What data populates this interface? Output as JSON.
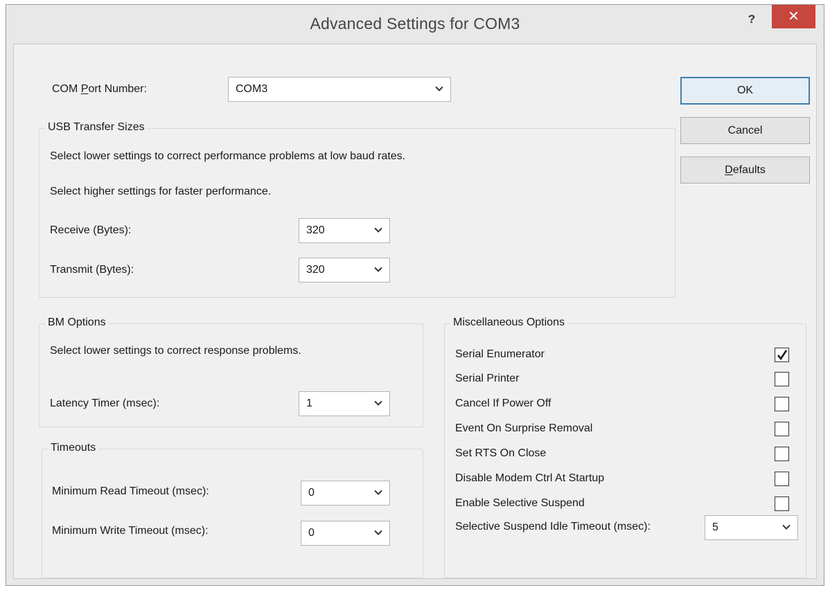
{
  "window": {
    "title": "Advanced Settings for COM3",
    "help_label": "?",
    "close_label": "✕"
  },
  "com_port": {
    "label_prefix": "COM ",
    "label_accel": "P",
    "label_rest": "ort Number:",
    "value": "COM3"
  },
  "buttons": {
    "ok": "OK",
    "cancel": "Cancel",
    "defaults_accel": "D",
    "defaults_rest": "efaults"
  },
  "usb_transfer": {
    "legend": "USB Transfer Sizes",
    "line1": "Select lower settings to correct performance problems at low baud rates.",
    "line2": "Select higher settings for faster performance.",
    "receive_label": "Receive (Bytes):",
    "receive_value": "320",
    "transmit_label": "Transmit (Bytes):",
    "transmit_value": "320"
  },
  "bm_options": {
    "legend": "BM Options",
    "description": "Select lower settings to correct response problems.",
    "latency_label": "Latency Timer (msec):",
    "latency_value": "1"
  },
  "timeouts": {
    "legend": "Timeouts",
    "read_label": "Minimum Read Timeout (msec):",
    "read_value": "0",
    "write_label": "Minimum Write Timeout (msec):",
    "write_value": "0"
  },
  "misc_options": {
    "legend": "Miscellaneous Options",
    "items": [
      {
        "label": "Serial Enumerator",
        "checked": true
      },
      {
        "label": "Serial Printer",
        "checked": false
      },
      {
        "label": "Cancel If Power Off",
        "checked": false
      },
      {
        "label": "Event On Surprise Removal",
        "checked": false
      },
      {
        "label": "Set RTS On Close",
        "checked": false
      },
      {
        "label": "Disable Modem Ctrl At Startup",
        "checked": false
      },
      {
        "label": "Enable Selective Suspend",
        "checked": false
      }
    ],
    "idle_timeout_label": "Selective Suspend Idle Timeout (msec):",
    "idle_timeout_value": "5"
  },
  "icons": {
    "dropdown": "chevron-down-icon",
    "check": "checkmark-icon"
  }
}
